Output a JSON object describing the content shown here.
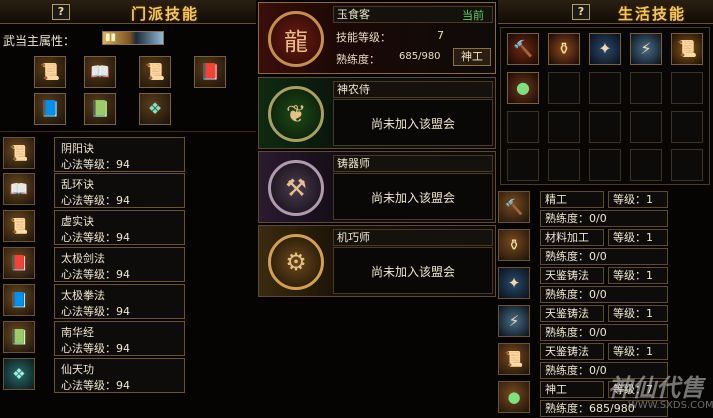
{
  "sect_panel": {
    "help_label": "?",
    "title": "门派技能",
    "main_attribute_label": "武当主属性：",
    "top_icons": [
      "scroll-icon",
      "book-icon",
      "scroll-icon",
      "book-icon",
      "book-icon",
      "book-icon",
      "gem-icon"
    ],
    "skills": [
      {
        "name": "阴阳诀",
        "level": "心法等级：94"
      },
      {
        "name": "乱环诀",
        "level": "心法等级：94"
      },
      {
        "name": "虚实诀",
        "level": "心法等级：94"
      },
      {
        "name": "太极剑法",
        "level": "心法等级：94"
      },
      {
        "name": "太极拳法",
        "level": "心法等级：94"
      },
      {
        "name": "南华经",
        "level": "心法等级：94"
      },
      {
        "name": "仙天功",
        "level": "心法等级：94"
      }
    ]
  },
  "profession_panel": {
    "cards": [
      {
        "name": "玉食客",
        "status": "当前",
        "skill_level_label": "技能等级：",
        "skill_level": "7",
        "proficiency_label": "熟练度：",
        "proficiency": "685/980",
        "title_button": "神工",
        "emblem": "dragon-icon"
      },
      {
        "name": "神农侍",
        "not_joined": "尚未加入该盟会",
        "emblem": "leaf-icon"
      },
      {
        "name": "铸器师",
        "not_joined": "尚未加入该盟会",
        "emblem": "anvil-icon"
      },
      {
        "name": "机巧师",
        "not_joined": "尚未加入该盟会",
        "emblem": "gear-icon"
      }
    ]
  },
  "life_panel": {
    "help_label": "?",
    "title": "生活技能",
    "rows": [
      {
        "name": "精工",
        "level": "等级：1",
        "proficiency": "熟练度：0/0"
      },
      {
        "name": "材料加工",
        "level": "等级：1",
        "proficiency": "熟练度：0/0"
      },
      {
        "name": "天鉴铸法",
        "level": "等级：1",
        "proficiency": "熟练度：0/0"
      },
      {
        "name": "天鉴铸法",
        "level": "等级：1",
        "proficiency": "熟练度：0/0"
      },
      {
        "name": "天鉴铸法",
        "level": "等级：1",
        "proficiency": "熟练度：0/0"
      },
      {
        "name": "神工",
        "level": "等级：7",
        "proficiency": "熟练度：685/980"
      }
    ]
  },
  "watermark": {
    "text": "神仙代售",
    "url": "WWW.SXDS.COM"
  }
}
